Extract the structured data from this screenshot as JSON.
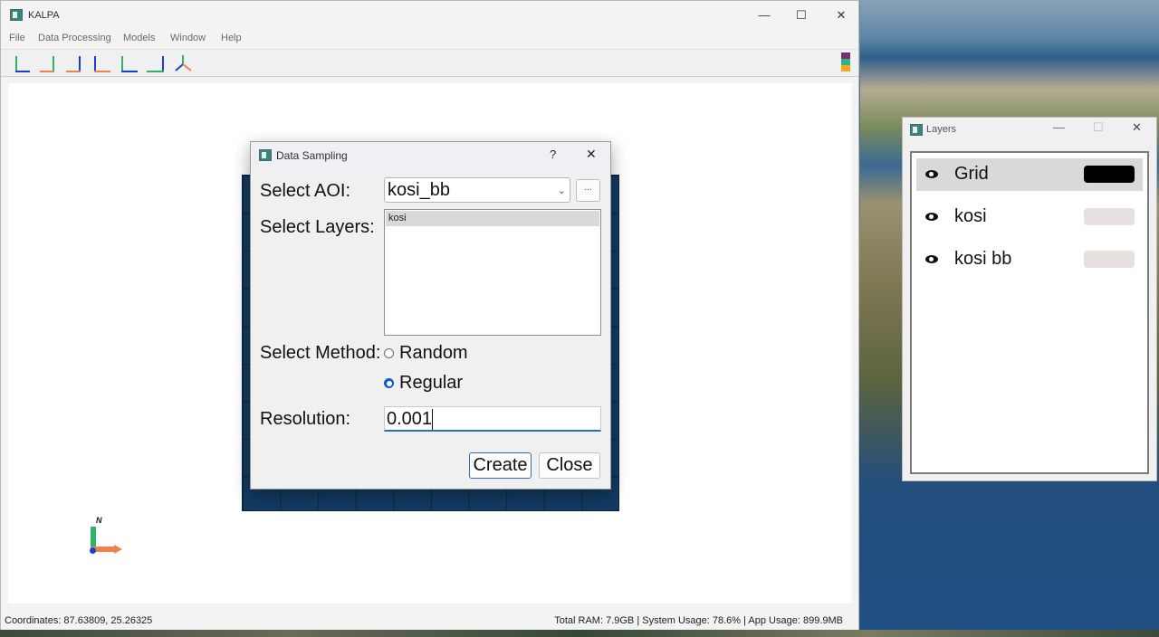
{
  "app": {
    "title": "KALPA",
    "menu": [
      "File",
      "Data Processing",
      "Models",
      "Window",
      "Help"
    ],
    "controls": {
      "minimize": "—",
      "maximize": "☐",
      "close": "✕"
    },
    "toolbar_colors": [
      "#7a2d6b",
      "#2fb38a",
      "#f5a623"
    ],
    "compass_label": "N",
    "status": {
      "coordinates": "Coordinates: 87.63809, 25.26325",
      "resources": "Total RAM: 7.9GB | System Usage: 78.6% | App Usage: 899.9MB"
    }
  },
  "dialog": {
    "title": "Data Sampling",
    "help": "?",
    "close": "✕",
    "aoi_label": "Select AOI:",
    "aoi_value": "kosi_bb",
    "browse_label": "...",
    "layers_label": "Select Layers:",
    "layers": [
      "kosi"
    ],
    "method_label": "Select Method:",
    "methods": [
      {
        "label": "Random",
        "selected": false
      },
      {
        "label": "Regular",
        "selected": true
      }
    ],
    "resolution_label": "Resolution:",
    "resolution_value": "0.001",
    "create_label": "Create",
    "close_label": "Close"
  },
  "layers_window": {
    "title": "Layers",
    "items": [
      {
        "name": "Grid",
        "color": "#000000",
        "selected": true
      },
      {
        "name": "kosi",
        "color": "#e6e1de",
        "selected": false
      },
      {
        "name": "kosi bb",
        "color": "#e6e1de",
        "selected": false
      }
    ]
  }
}
